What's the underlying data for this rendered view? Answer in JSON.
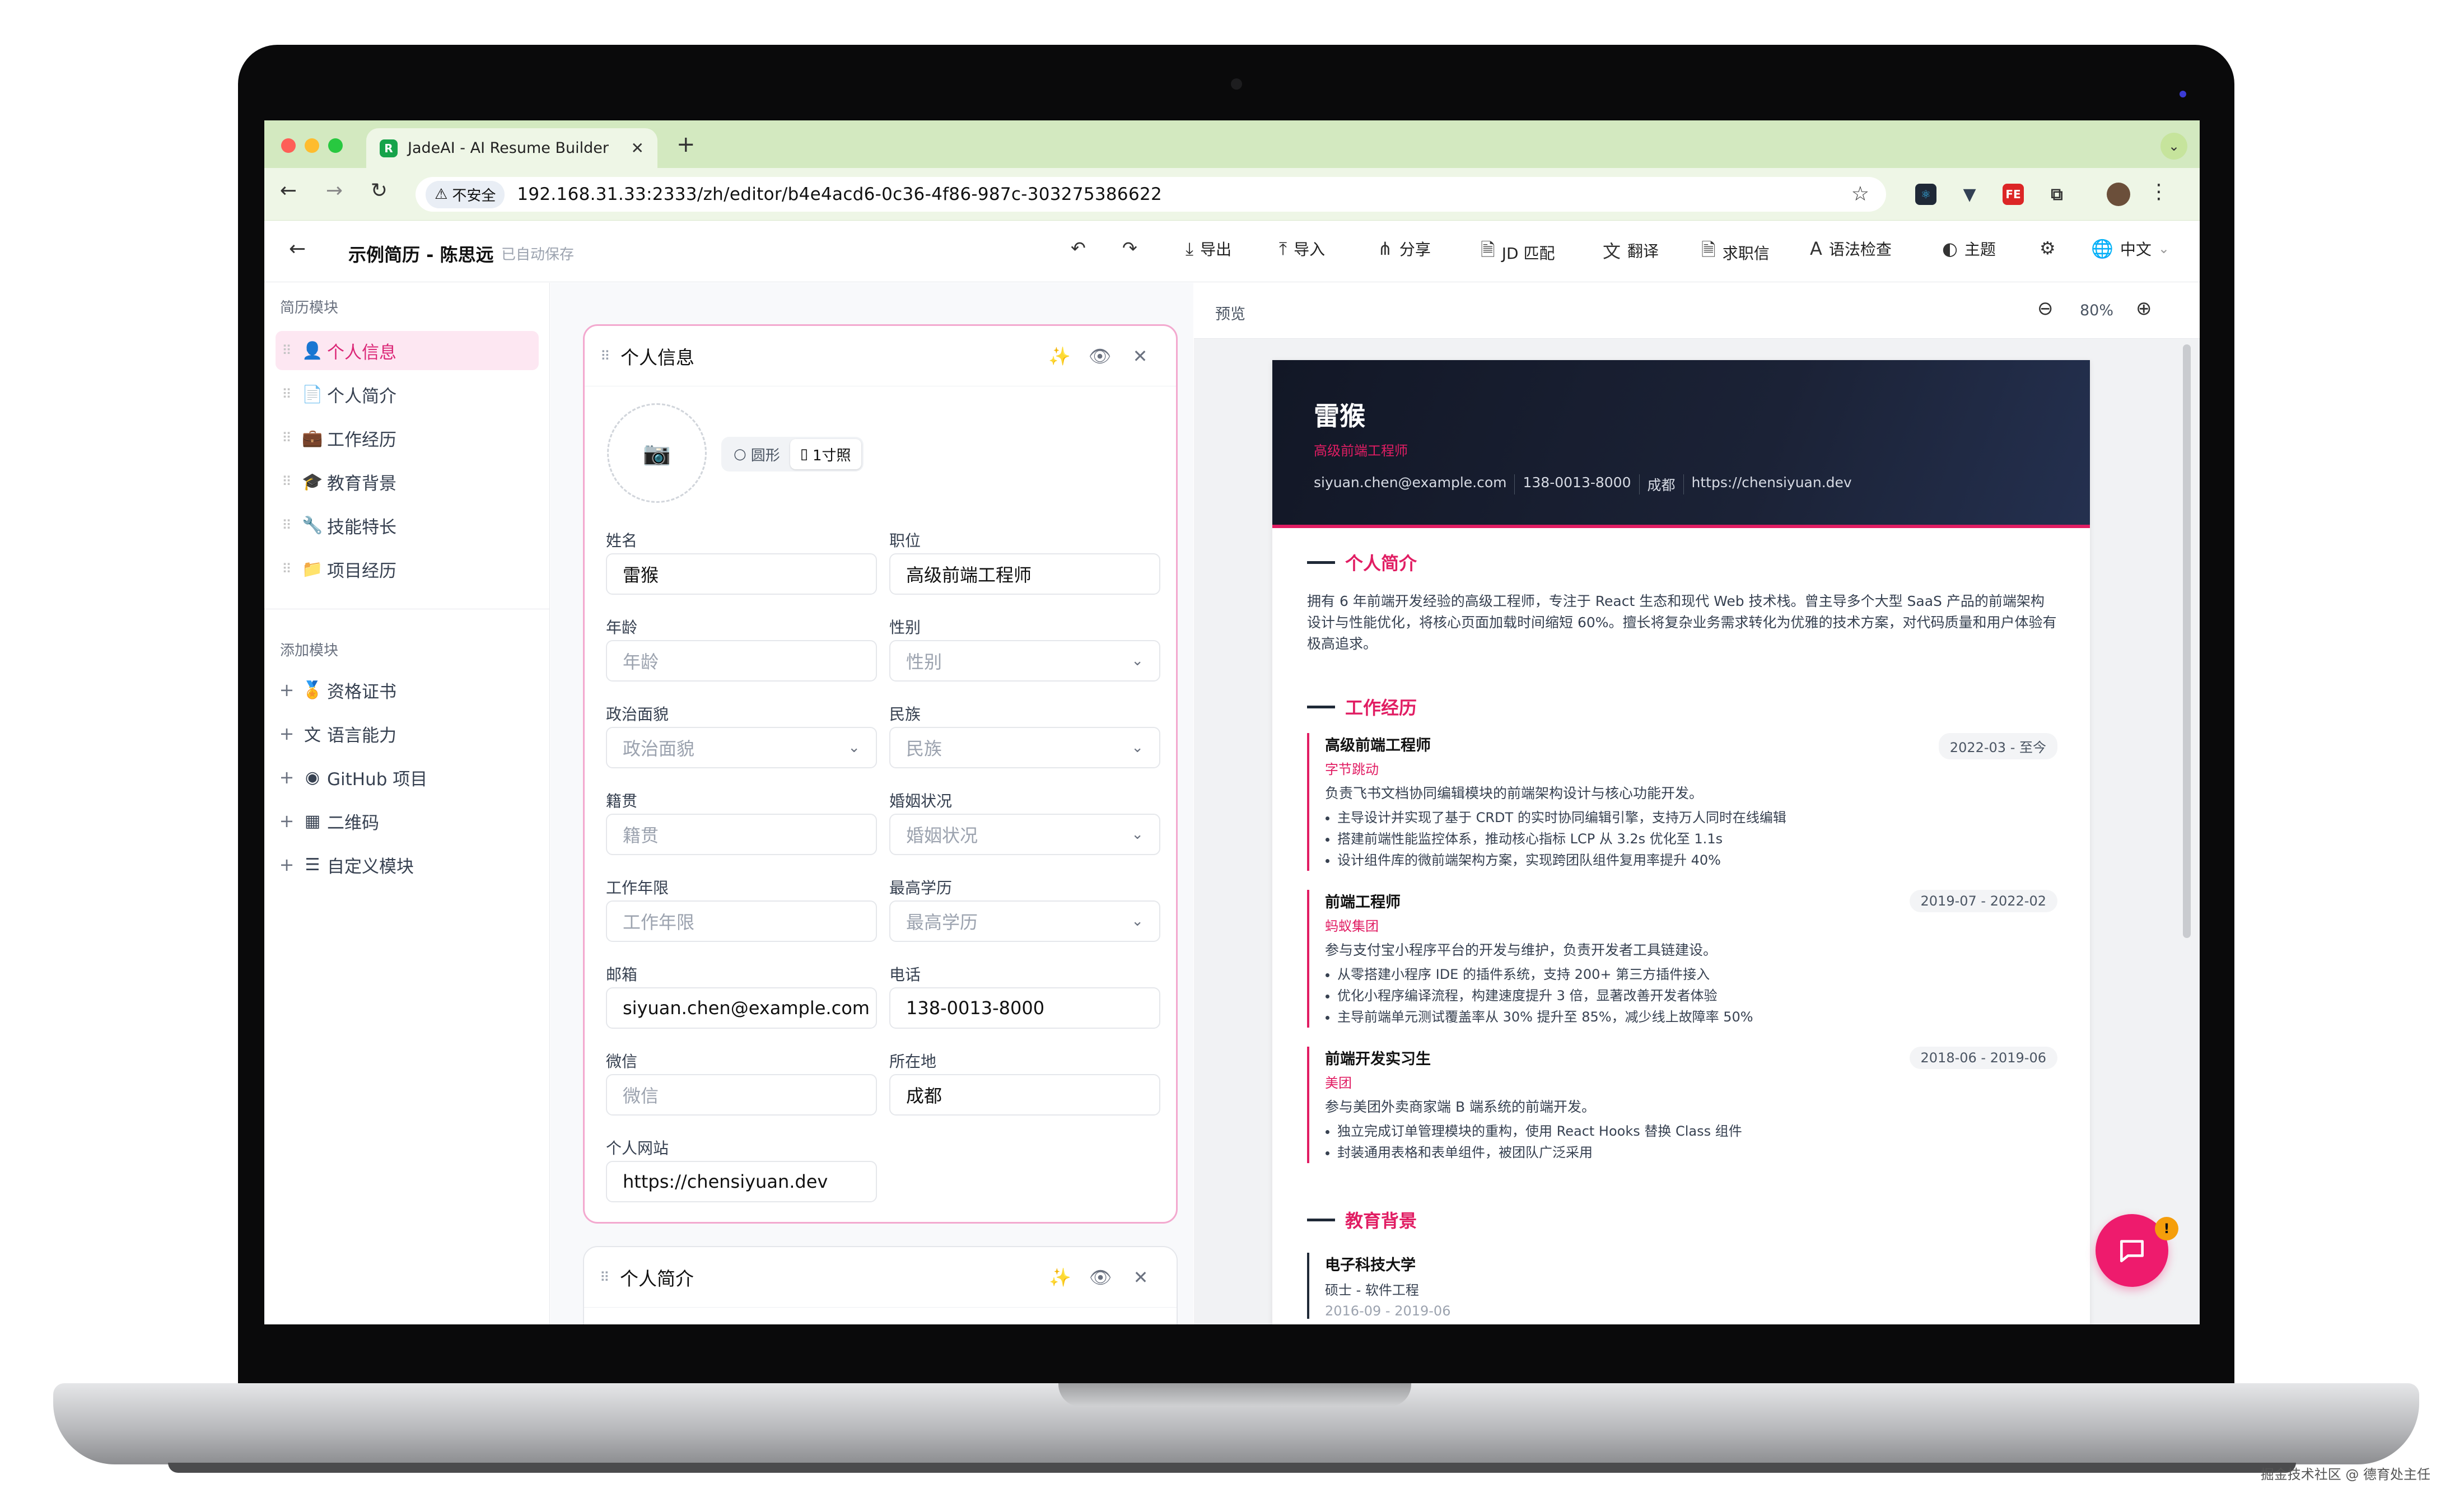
{
  "browser": {
    "tab_title": "JadeAI - AI Resume Builder",
    "favicon_letter": "R",
    "new_tab": "+",
    "not_secure": "不安全",
    "url": "192.168.31.33:2333/zh/editor/b4e4acd6-0c36-4f86-987c-303275386622"
  },
  "header": {
    "doc_title": "示例简历 - 陈思远",
    "autosave": "已自动保存",
    "buttons": {
      "export": "导出",
      "import": "导入",
      "share": "分享",
      "jd_match": "JD 匹配",
      "translate": "翻译",
      "cover_letter": "求职信",
      "grammar": "语法检查",
      "theme": "主题",
      "language": "中文"
    }
  },
  "sidebar": {
    "section_modules": "简历模块",
    "modules": [
      {
        "label": "个人信息",
        "icon": "user-icon",
        "glyph": "👤"
      },
      {
        "label": "个人简介",
        "icon": "document-icon",
        "glyph": "📄"
      },
      {
        "label": "工作经历",
        "icon": "briefcase-icon",
        "glyph": "💼"
      },
      {
        "label": "教育背景",
        "icon": "graduation-cap-icon",
        "glyph": "🎓"
      },
      {
        "label": "技能特长",
        "icon": "wrench-icon",
        "glyph": "🔧"
      },
      {
        "label": "项目经历",
        "icon": "folder-icon",
        "glyph": "📁"
      }
    ],
    "section_add": "添加模块",
    "add_modules": [
      {
        "label": "资格证书",
        "icon": "award-icon",
        "glyph": "🏅"
      },
      {
        "label": "语言能力",
        "icon": "translate-icon",
        "glyph": "文"
      },
      {
        "label": "GitHub 项目",
        "icon": "github-icon",
        "glyph": "◉"
      },
      {
        "label": "二维码",
        "icon": "qrcode-icon",
        "glyph": "▦"
      },
      {
        "label": "自定义模块",
        "icon": "layout-list-icon",
        "glyph": "☰"
      }
    ]
  },
  "editor": {
    "card_title": "个人信息",
    "photo_shapes": {
      "circle": "圆形",
      "one_inch": "1寸照"
    },
    "fields": {
      "name": {
        "label": "姓名",
        "value": "雷猴"
      },
      "position": {
        "label": "职位",
        "value": "高级前端工程师"
      },
      "age": {
        "label": "年龄",
        "placeholder": "年龄"
      },
      "gender": {
        "label": "性别",
        "placeholder": "性别"
      },
      "political": {
        "label": "政治面貌",
        "placeholder": "政治面貌"
      },
      "ethnicity": {
        "label": "民族",
        "placeholder": "民族"
      },
      "hometown": {
        "label": "籍贯",
        "placeholder": "籍贯"
      },
      "marital": {
        "label": "婚姻状况",
        "placeholder": "婚姻状况"
      },
      "years": {
        "label": "工作年限",
        "placeholder": "工作年限"
      },
      "education": {
        "label": "最高学历",
        "placeholder": "最高学历"
      },
      "email": {
        "label": "邮箱",
        "value": "siyuan.chen@example.com"
      },
      "phone": {
        "label": "电话",
        "value": "138-0013-8000"
      },
      "wechat": {
        "label": "微信",
        "placeholder": "微信"
      },
      "location": {
        "label": "所在地",
        "value": "成都"
      },
      "website": {
        "label": "个人网站",
        "value": "https://chensiyuan.dev"
      }
    },
    "card2_title": "个人简介"
  },
  "preview": {
    "label": "预览",
    "zoom": "80%",
    "resume": {
      "name": "雷猴",
      "title": "高级前端工程师",
      "contacts": [
        "siyuan.chen@example.com",
        "138-0013-8000",
        "成都",
        "https://chensiyuan.dev"
      ],
      "summary_title": "个人简介",
      "summary": "拥有 6 年前端开发经验的高级工程师，专注于 React 生态和现代 Web 技术栈。曾主导多个大型 SaaS 产品的前端架构设计与性能优化，将核心页面加载时间缩短 60%。擅长将复杂业务需求转化为优雅的技术方案，对代码质量和用户体验有极高追求。",
      "work_title": "工作经历",
      "jobs": [
        {
          "title": "高级前端工程师",
          "company": "字节跳动",
          "date": "2022-03 - 至今",
          "desc": "负责飞书文档协同编辑模块的前端架构设计与核心功能开发。",
          "bullets": [
            "主导设计并实现了基于 CRDT 的实时协同编辑引擎，支持万人同时在线编辑",
            "搭建前端性能监控体系，推动核心指标 LCP 从 3.2s 优化至 1.1s",
            "设计组件库的微前端架构方案，实现跨团队组件复用率提升 40%"
          ]
        },
        {
          "title": "前端工程师",
          "company": "蚂蚁集团",
          "date": "2019-07 - 2022-02",
          "desc": "参与支付宝小程序平台的开发与维护，负责开发者工具链建设。",
          "bullets": [
            "从零搭建小程序 IDE 的插件系统，支持 200+ 第三方插件接入",
            "优化小程序编译流程，构建速度提升 3 倍，显著改善开发者体验",
            "主导前端单元测试覆盖率从 30% 提升至 85%，减少线上故障率 50%"
          ]
        },
        {
          "title": "前端开发实习生",
          "company": "美团",
          "date": "2018-06 - 2019-06",
          "desc": "参与美团外卖商家端 B 端系统的前端开发。",
          "bullets": [
            "独立完成订单管理模块的重构，使用 React Hooks 替换 Class 组件",
            "封装通用表格和表单组件，被团队广泛采用"
          ]
        }
      ],
      "edu_title": "教育背景",
      "school": "电子科技大学",
      "degree": "硕士 - 软件工程",
      "edu_date": "2016-09 - 2019-06"
    }
  },
  "watermark": "掘金技术社区 @ 德育处主任",
  "colors": {
    "accent": "#db2777",
    "resume_accent": "#e11d63",
    "tabbar": "#d3e9c0",
    "resume_header": "#121726"
  }
}
